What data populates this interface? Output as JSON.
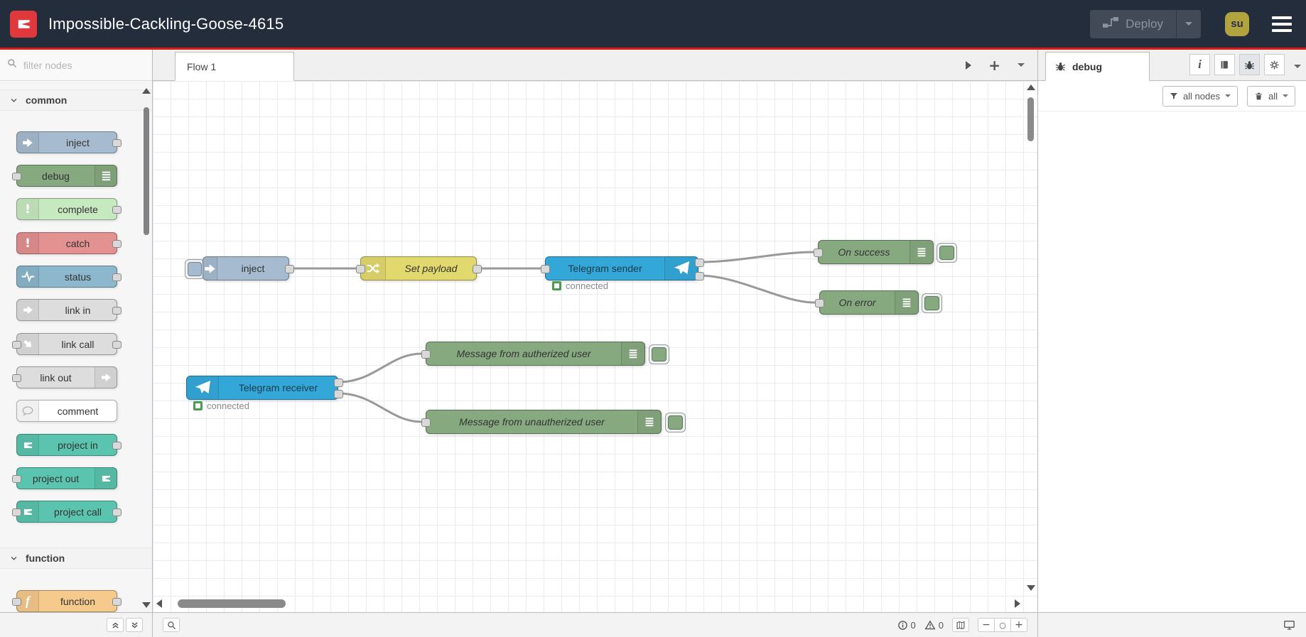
{
  "header": {
    "title": "Impossible-Cackling-Goose-4615",
    "deploy": {
      "label": "Deploy"
    },
    "user": {
      "initials": "su"
    }
  },
  "palette": {
    "search": {
      "placeholder": "filter nodes"
    },
    "categories": [
      {
        "label": "common",
        "items": [
          {
            "label": "inject"
          },
          {
            "label": "debug"
          },
          {
            "label": "complete"
          },
          {
            "label": "catch"
          },
          {
            "label": "status"
          },
          {
            "label": "link in"
          },
          {
            "label": "link call"
          },
          {
            "label": "link out"
          },
          {
            "label": "comment"
          },
          {
            "label": "project in"
          },
          {
            "label": "project out"
          },
          {
            "label": "project call"
          }
        ]
      },
      {
        "label": "function",
        "items": [
          {
            "label": "function"
          }
        ]
      }
    ]
  },
  "workspace": {
    "tabs": [
      {
        "label": "Flow 1"
      }
    ],
    "nodes": [
      {
        "label": "inject"
      },
      {
        "label": "Set payload"
      },
      {
        "label": "Telegram sender",
        "status": "connected"
      },
      {
        "label": "On success"
      },
      {
        "label": "On error"
      },
      {
        "label": "Telegram receiver",
        "status": "connected"
      },
      {
        "label": "Message from autherized user"
      },
      {
        "label": "Message from unautherized user"
      }
    ]
  },
  "sidebar": {
    "tab_label": "debug",
    "filter_button": "all nodes",
    "clear_button": "all"
  },
  "statusbar": {
    "info_count": "0",
    "warning_count": "0"
  },
  "colors": {
    "accent_red": "#dc1a1a",
    "header_bg": "#232d3b",
    "inject": "#a6bbcf",
    "debug_green": "#87a980",
    "complete": "#c7e9c0",
    "catch": "#e49191",
    "status_node": "#8cb7cd",
    "link": "#dddddd",
    "comment": "#ffffff",
    "project": "#5bc4ae",
    "function": "#f6c98c",
    "change_yellow": "#e2d96e",
    "telegram_blue": "#33a7d8",
    "status_ok_green": "#4a9e4e",
    "wire": "#999999"
  }
}
